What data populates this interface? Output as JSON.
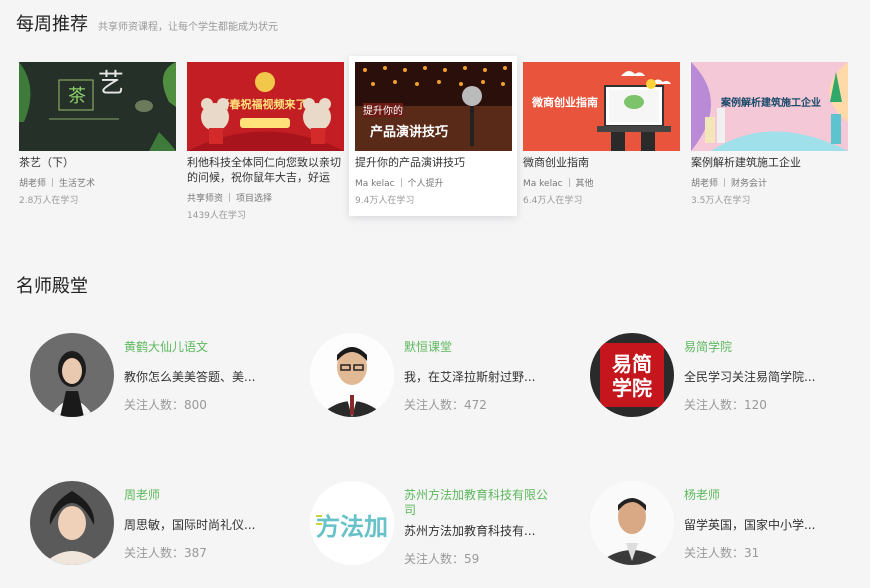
{
  "weekly": {
    "title": "每周推荐",
    "subtitle": "共享师资课程，让每个学生都能成为状元",
    "courses": [
      {
        "title": "茶艺（下）",
        "teacher": "胡老师",
        "category": "生活艺术",
        "learners": "2.8万人在学习",
        "thumb_text": "艺",
        "thumb_bg": "#243028"
      },
      {
        "title": "利他科技全体同仁向您致以亲切的问候，祝你鼠年大吉，好运连...",
        "teacher": "共享师资",
        "category": "项目选择",
        "learners": "1439人在学习",
        "thumb_text": "新春祝福视频来了!",
        "thumb_bg": "#c41e25"
      },
      {
        "title": "提升你的产品演讲技巧",
        "teacher": "Ma kelac",
        "category": "个人提升",
        "learners": "9.4万人在学习",
        "thumb_text": "产品演讲技巧",
        "thumb_text2": "提升你的",
        "thumb_bg": "#3a1a12"
      },
      {
        "title": "微商创业指南",
        "teacher": "Ma kelac",
        "category": "其他",
        "learners": "6.4万人在学习",
        "thumb_text": "微商创业指南",
        "thumb_bg": "#e8543c"
      },
      {
        "title": "案例解析建筑施工企业",
        "teacher": "胡老师",
        "category": "财务会计",
        "learners": "3.5万人在学习",
        "thumb_text": "案例解析建筑施工企业",
        "thumb_bg": "#7fd3e0"
      }
    ]
  },
  "hall": {
    "title": "名师殿堂",
    "follow_label": "关注人数：",
    "teachers": [
      {
        "name": "黄鹤大仙儿语文",
        "desc": "教你怎么美美答题、美...",
        "followers": "800"
      },
      {
        "name": "默恒课堂",
        "desc": "我，在艾泽拉斯射过野...",
        "followers": "472"
      },
      {
        "name": "易简学院",
        "desc": "全民学习关注易简学院...",
        "followers": "120",
        "logo_text": "易简学院"
      },
      {
        "name": "周老师",
        "desc": "周思敏，国际时尚礼仪...",
        "followers": "387"
      },
      {
        "name": "苏州方法加教育科技有限公司",
        "desc": "苏州方法加教育科技有...",
        "followers": "59",
        "logo_text": "方法加"
      },
      {
        "name": "杨老师",
        "desc": "留学英国，国家中小学...",
        "followers": "31"
      }
    ]
  },
  "colors": {
    "accent_green": "#5cb85c",
    "background": "#f5f5f6"
  }
}
